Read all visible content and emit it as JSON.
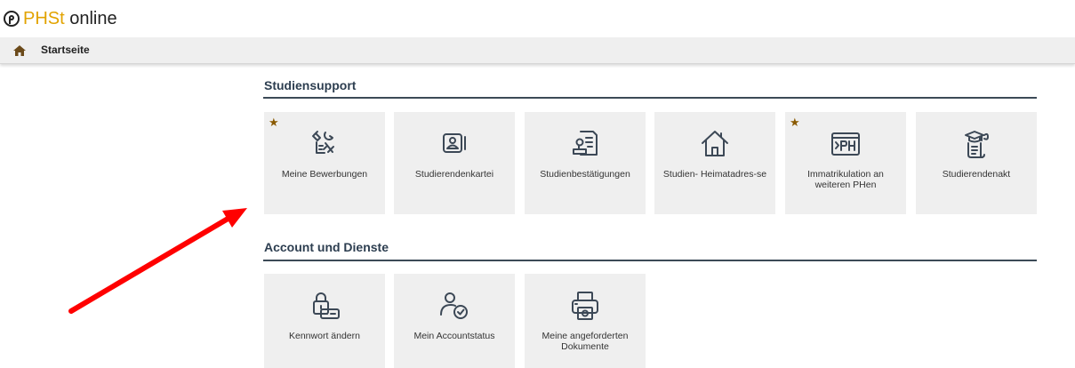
{
  "header": {
    "logo_accent": "PHSt",
    "logo_rest": " online"
  },
  "navbar": {
    "home_label": "Startseite"
  },
  "sections": [
    {
      "title": "Studiensupport",
      "tiles": [
        {
          "label": "Meine Bewerbungen",
          "icon": "application-tools-icon",
          "favorite": true
        },
        {
          "label": "Studierendenkartei",
          "icon": "id-card-icon",
          "favorite": false
        },
        {
          "label": "Studienbestätigungen",
          "icon": "certificate-stamp-icon",
          "favorite": false
        },
        {
          "label": "Studien- Heimatadres-se",
          "icon": "home-icon",
          "favorite": false
        },
        {
          "label": "Immatrikulation an weiteren PHen",
          "icon": "ph-terminal-icon",
          "favorite": true
        },
        {
          "label": "Studierendenakt",
          "icon": "graduate-scroll-icon",
          "favorite": false
        }
      ]
    },
    {
      "title": "Account und Dienste",
      "tiles": [
        {
          "label": "Kennwort ändern",
          "icon": "lock-password-icon",
          "favorite": false
        },
        {
          "label": "Mein Accountstatus",
          "icon": "user-check-icon",
          "favorite": false
        },
        {
          "label": "Meine angeforderten Dokumente",
          "icon": "printer-icon",
          "favorite": false
        }
      ]
    }
  ],
  "favorite_glyph": "★",
  "colors": {
    "accent": "#e2a300",
    "tile_bg": "#efefef",
    "icon_stroke": "#3c4856",
    "star": "#8a5a00",
    "annotation_arrow": "#ff0000"
  }
}
